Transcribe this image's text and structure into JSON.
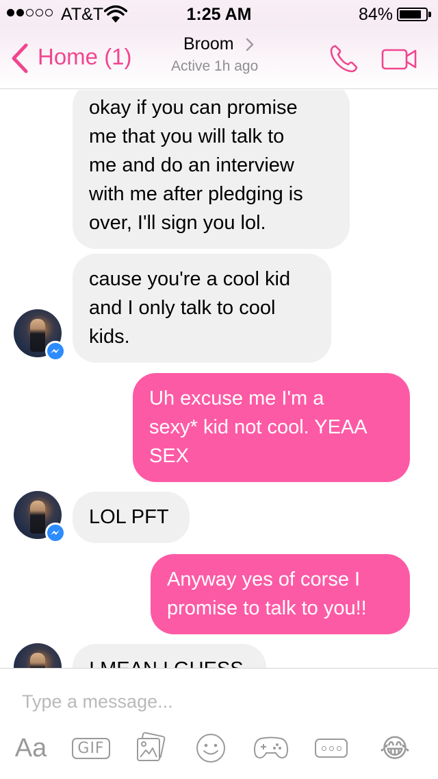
{
  "status_bar": {
    "carrier": "AT&T",
    "time": "1:25 AM",
    "battery": "84%",
    "signal_bars_filled": 2,
    "signal_bars_total": 5
  },
  "header": {
    "back_label": "Home (1)",
    "contact_name": "Broom",
    "contact_status": "Active 1h ago",
    "accent_color": "#f0468f",
    "icons": [
      "chevron-left-icon",
      "chevron-right-icon",
      "phone-icon",
      "video-camera-icon"
    ]
  },
  "messages": [
    {
      "direction": "incoming",
      "lines": [
        "okay if you can promise",
        "me that you will talk to",
        "me and do an interview",
        "with me after pledging is",
        "over, I'll sign you lol."
      ]
    },
    {
      "direction": "incoming",
      "lines": [
        "cause you're a cool kid",
        "and I only talk to cool",
        "kids."
      ]
    },
    {
      "direction": "outgoing",
      "lines": [
        "Uh excuse me I'm a",
        "sexy* kid not cool. YEAA",
        "SEX"
      ]
    },
    {
      "direction": "incoming",
      "lines": [
        "LOL PFT"
      ]
    },
    {
      "direction": "outgoing",
      "lines": [
        "Anyway yes of corse I",
        "promise to talk to you!!"
      ]
    },
    {
      "direction": "incoming",
      "lines": [
        "I MEAN I GUESS"
      ]
    }
  ],
  "bubble_colors": {
    "incoming": "#f1f0f0",
    "outgoing": "#fd5aa5",
    "messenger_badge": "#2d8cff"
  },
  "composer": {
    "placeholder": "Type a message...",
    "aa_label": "Aa",
    "gif_label": "GIF",
    "emoji": "😂",
    "icons": [
      "text-format-icon",
      "gif-icon",
      "photo-icon",
      "sticker-icon",
      "game-controller-icon",
      "more-icon",
      "emoji-icon"
    ]
  }
}
